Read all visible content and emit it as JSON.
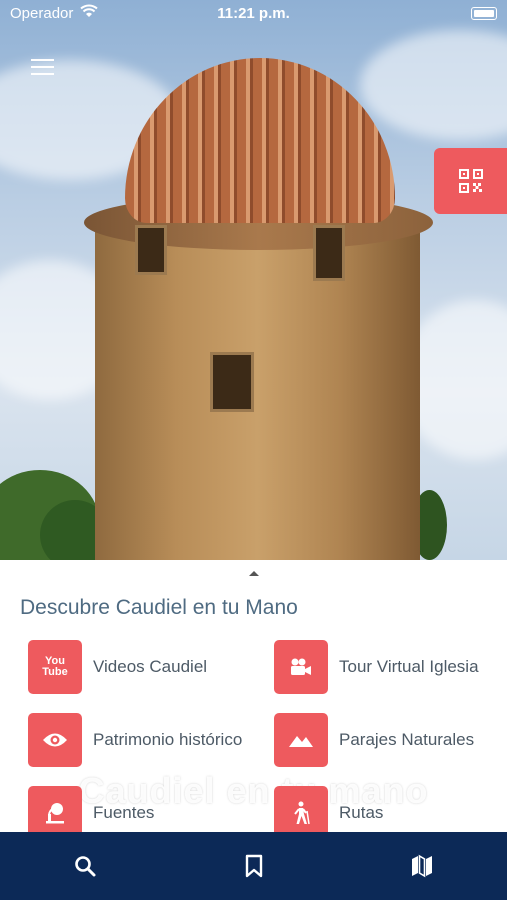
{
  "status_bar": {
    "carrier": "Operador",
    "time": "11:21 p.m."
  },
  "panel": {
    "title": "Descubre Caudiel en tu Mano",
    "background_text": "Caudiel en tu mano",
    "items": [
      {
        "label": "Videos Caudiel",
        "icon": "youtube-icon"
      },
      {
        "label": "Tour Virtual Iglesia",
        "icon": "video-camera-icon"
      },
      {
        "label": "Patrimonio histórico",
        "icon": "eye-icon"
      },
      {
        "label": "Parajes Naturales",
        "icon": "mountain-icon"
      },
      {
        "label": "Fuentes",
        "icon": "fountain-icon"
      },
      {
        "label": "Rutas",
        "icon": "hiker-icon"
      }
    ],
    "youtube_text": {
      "line1": "You",
      "line2": "Tube"
    }
  },
  "tabbar": {
    "tabs": [
      "search-icon",
      "bookmark-icon",
      "map-icon"
    ]
  },
  "colors": {
    "accent": "#ee5a5e",
    "tabbar": "#0c2957",
    "title": "#4f6b82"
  }
}
